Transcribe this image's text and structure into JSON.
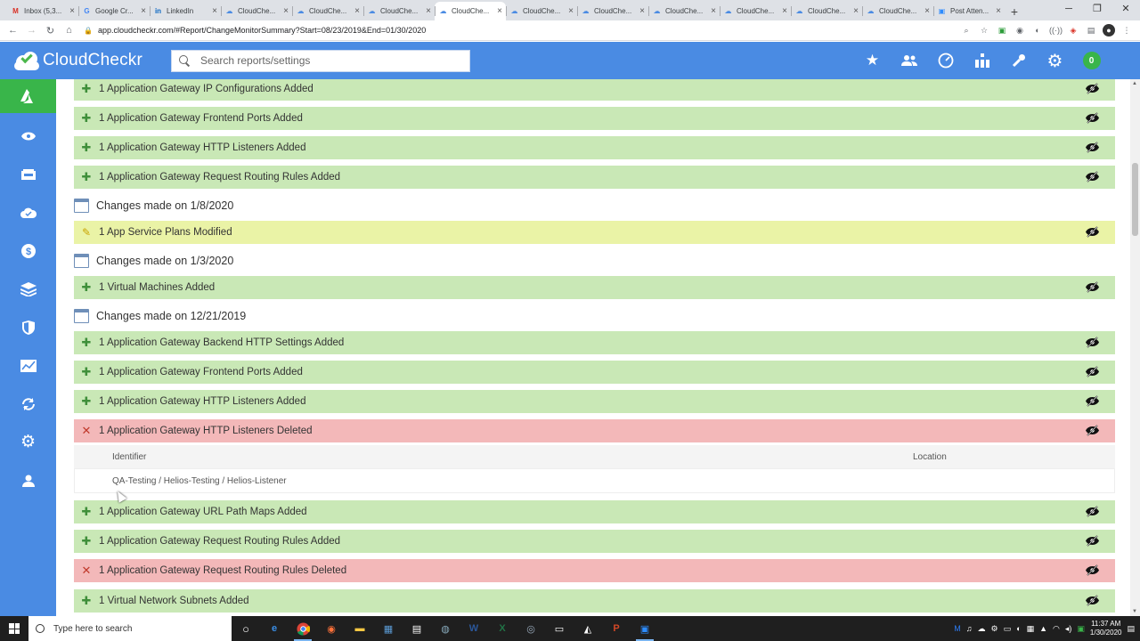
{
  "browser": {
    "tabs": [
      {
        "label": "Inbox (5,3...",
        "icon": "M",
        "color": "#d93025",
        "active": false
      },
      {
        "label": "Google Cr...",
        "icon": "G",
        "color": "#4285f4",
        "active": false
      },
      {
        "label": "LinkedIn",
        "icon": "in",
        "color": "#0a66c2",
        "active": false
      },
      {
        "label": "CloudChe...",
        "icon": "☁",
        "color": "#4a8be3",
        "active": false
      },
      {
        "label": "CloudChe...",
        "icon": "☁",
        "color": "#4a8be3",
        "active": false
      },
      {
        "label": "CloudChe...",
        "icon": "☁",
        "color": "#4a8be3",
        "active": false
      },
      {
        "label": "CloudChe...",
        "icon": "☁",
        "color": "#4a8be3",
        "active": true
      },
      {
        "label": "CloudChe...",
        "icon": "☁",
        "color": "#4a8be3",
        "active": false
      },
      {
        "label": "CloudChe...",
        "icon": "☁",
        "color": "#4a8be3",
        "active": false
      },
      {
        "label": "CloudChe...",
        "icon": "☁",
        "color": "#4a8be3",
        "active": false
      },
      {
        "label": "CloudChe...",
        "icon": "☁",
        "color": "#4a8be3",
        "active": false
      },
      {
        "label": "CloudChe...",
        "icon": "☁",
        "color": "#4a8be3",
        "active": false
      },
      {
        "label": "CloudChe...",
        "icon": "☁",
        "color": "#4a8be3",
        "active": false
      },
      {
        "label": "Post Atten...",
        "icon": "▣",
        "color": "#2d8cff",
        "active": false
      }
    ],
    "url": "app.cloudcheckr.com/#Report/ChangeMonitorSummary?Start=08/23/2019&End=01/30/2020"
  },
  "header": {
    "brand": "CloudCheckr",
    "search_placeholder": "Search reports/settings",
    "notification_count": "0"
  },
  "changes": [
    {
      "type": "added",
      "text": "1 Application Gateway IP Configurations Added"
    },
    {
      "type": "added",
      "text": "1 Application Gateway Frontend Ports Added"
    },
    {
      "type": "added",
      "text": "1 Application Gateway HTTP Listeners Added"
    },
    {
      "type": "added",
      "text": "1 Application Gateway Request Routing Rules Added"
    },
    {
      "type": "date",
      "text": "Changes made on 1/8/2020"
    },
    {
      "type": "modified",
      "text": "1 App Service Plans Modified"
    },
    {
      "type": "date",
      "text": "Changes made on 1/3/2020"
    },
    {
      "type": "added",
      "text": "1 Virtual Machines Added"
    },
    {
      "type": "date",
      "text": "Changes made on 12/21/2019"
    },
    {
      "type": "added",
      "text": "1 Application Gateway Backend HTTP Settings Added"
    },
    {
      "type": "added",
      "text": "1 Application Gateway Frontend Ports Added"
    },
    {
      "type": "added",
      "text": "1 Application Gateway HTTP Listeners Added"
    },
    {
      "type": "deleted",
      "text": "1 Application Gateway HTTP Listeners Deleted"
    },
    {
      "type": "added",
      "text": "1 Application Gateway URL Path Maps Added"
    },
    {
      "type": "added",
      "text": "1 Application Gateway Request Routing Rules Added"
    },
    {
      "type": "deleted",
      "text": "1 Application Gateway Request Routing Rules Deleted"
    },
    {
      "type": "added",
      "text": "1 Virtual Network Subnets Added"
    }
  ],
  "detail": {
    "col_identifier": "Identifier",
    "col_location": "Location",
    "identifier_value": "QA-Testing / Helios-Testing / Helios-Listener"
  },
  "taskbar": {
    "search_placeholder": "Type here to search",
    "time": "11:37 AM",
    "date": "1/30/2020"
  },
  "colors": {
    "accent": "#4a8be3",
    "active_nav": "#39b54a",
    "added_row": "#c9e8b6",
    "modified_row": "#eaf3a6",
    "deleted_row": "#f3b8b9"
  }
}
